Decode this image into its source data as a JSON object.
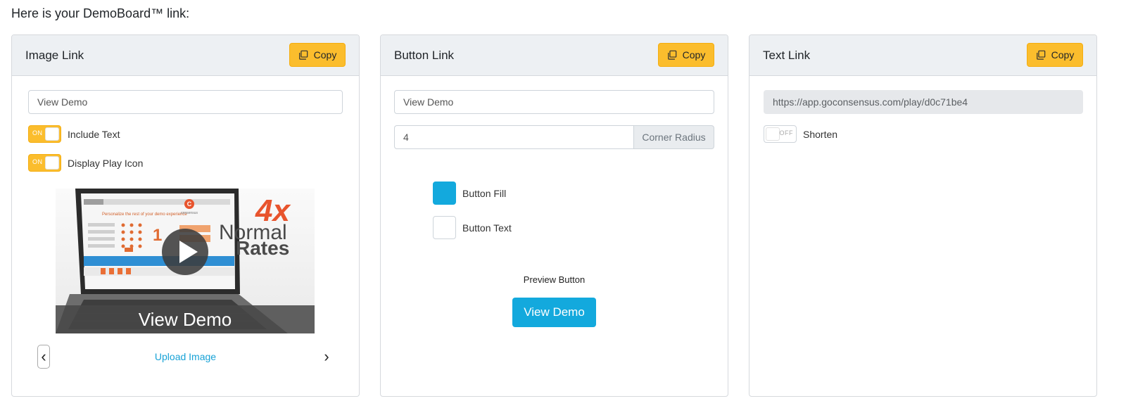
{
  "intro_text": "Here is your DemoBoard™ link:",
  "colors": {
    "accent": "#fbbd2d",
    "button_fill": "#13a9dd",
    "button_text": "#ffffff",
    "link": "#17a2d6"
  },
  "image_card": {
    "title": "Image Link",
    "copy_label": "Copy",
    "text_value": "View Demo",
    "include_text": {
      "state": "ON",
      "label": "Include Text"
    },
    "display_play_icon": {
      "state": "ON",
      "label": "Display Play Icon"
    },
    "image": {
      "badge": "4x",
      "headline_1": "Normal",
      "headline_2": "Rates",
      "caption": "View Demo",
      "screen_title": "Personalize the rest of your demo experience",
      "screen_number": "1",
      "brand": "consensus"
    },
    "upload_label": "Upload Image",
    "prev_glyph": "‹",
    "next_glyph": "›"
  },
  "button_card": {
    "title": "Button Link",
    "copy_label": "Copy",
    "text_value": "View Demo",
    "corner_radius_value": "4",
    "corner_radius_label": "Corner Radius",
    "fill_label": "Button Fill",
    "text_color_label": "Button Text",
    "preview_label": "Preview Button",
    "preview_button_text": "View Demo"
  },
  "text_card": {
    "title": "Text Link",
    "copy_label": "Copy",
    "url": "https://app.goconsensus.com/play/d0c71be4",
    "shorten": {
      "state": "OFF",
      "label": "Shorten"
    }
  }
}
